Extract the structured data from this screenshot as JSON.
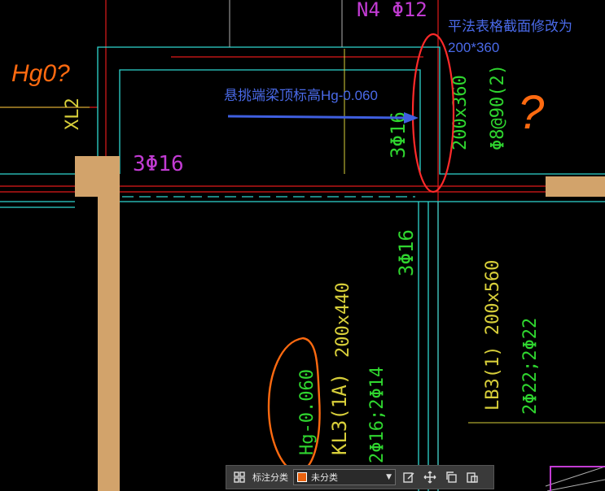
{
  "drawing": {
    "labels": {
      "top_fragment": "N4 Φ12",
      "left_vertical_code": "XL2",
      "bottom_rebar_left": "3Φ16",
      "beam_vertical_rebar": "3Φ16",
      "beam_section": "200x360",
      "stirrup": "Φ8@90(2)",
      "mid_rebar": "3Φ16",
      "lb3_name": "LB3(1) 200x560",
      "lb3_rebar": "2Φ22;2Φ22",
      "kl3_size": "200x440",
      "kl3_name": "KL3(1A)",
      "kl3_rebar": "2Φ16;2Φ14",
      "hg_circled": "Hg-0.060"
    },
    "annotations": {
      "markup_note_top": "平法表格截面修改为",
      "markup_note_top2": "200*360",
      "arrow_note": "悬挑端梁顶标高Hg-0.060",
      "handwriting_left": "Hg0?",
      "question_mark": "?"
    },
    "colors": {
      "background": "#000000",
      "cyan_line": "#2fd6cf",
      "red_axis": "#e01b1b",
      "green_text": "#2fd62f",
      "yellow_text": "#d8cf3a",
      "magenta_text": "#c23bd3",
      "column_fill": "#d2a36b",
      "markup_red": "#ff2a2a",
      "markup_orange": "#ff6a10",
      "markup_blue": "#3f5fe0"
    }
  },
  "toolbar": {
    "grid_icon": "grid-icon",
    "category_label": "标注分类",
    "category_value": "未分类",
    "edit_icon": "edit-icon",
    "move_icon": "move-icon",
    "copy_icon": "copy-icon",
    "paste_icon": "paste-icon"
  }
}
